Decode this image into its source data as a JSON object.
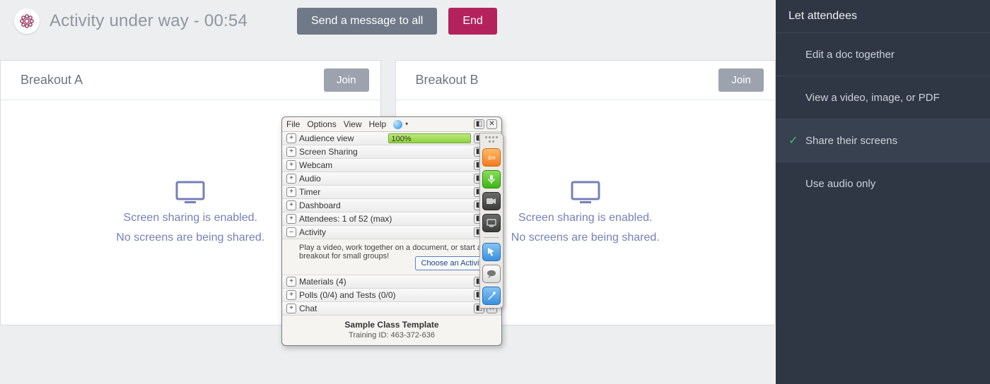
{
  "header": {
    "title": "Activity under way - 00:54",
    "send_all_label": "Send a message to all",
    "end_label": "End"
  },
  "sidebar": {
    "heading": "Let attendees",
    "items": [
      {
        "label": "Edit a doc together",
        "selected": false
      },
      {
        "label": "View a video, image, or PDF",
        "selected": false
      },
      {
        "label": "Share their screens",
        "selected": true
      },
      {
        "label": "Use audio only",
        "selected": false
      }
    ]
  },
  "breakouts": [
    {
      "name": "Breakout A",
      "join_label": "Join",
      "status_line1": "Screen sharing is enabled.",
      "status_line2": "No screens are being shared."
    },
    {
      "name": "Breakout B",
      "join_label": "Join",
      "status_line1": "Screen sharing is enabled.",
      "status_line2": "No screens are being shared."
    }
  ],
  "panel": {
    "menus": {
      "file": "File",
      "options": "Options",
      "view": "View",
      "help": "Help"
    },
    "rows": {
      "audience_view": {
        "label": "Audience view",
        "percent": "100%"
      },
      "screen_sharing": "Screen Sharing",
      "webcam": "Webcam",
      "audio": "Audio",
      "timer": "Timer",
      "dashboard": "Dashboard",
      "attendees": "Attendees:  1 of 52 (max)",
      "activity": "Activity",
      "materials": "Materials (4)",
      "polls": "Polls (0/4) and Tests (0/0)",
      "chat": "Chat"
    },
    "activity_body": "Play a video, work together on a document, or start a breakout for small groups!",
    "choose_button": "Choose an Activity",
    "footer_title": "Sample Class Template",
    "footer_id": "Training ID: 463-372-636"
  }
}
